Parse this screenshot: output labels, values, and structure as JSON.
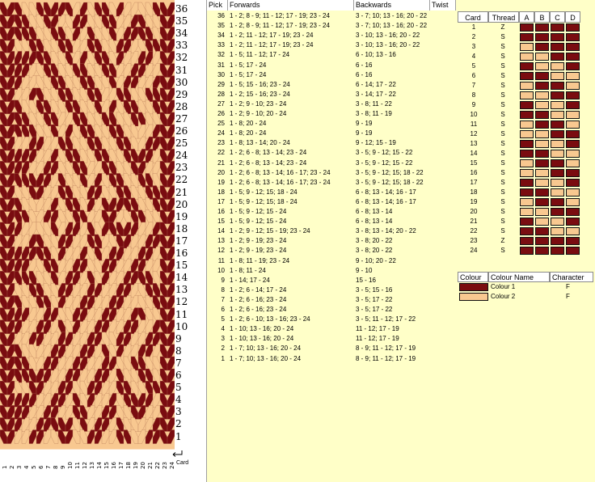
{
  "colors": {
    "dark": "#7a0c10",
    "light": "#f8c890",
    "panel_bg": "#ffffc8",
    "header_bg": "#ffffff"
  },
  "pattern": {
    "row_labels": [
      "36",
      "35",
      "34",
      "33",
      "32",
      "31",
      "30",
      "29",
      "28",
      "27",
      "26",
      "25",
      "24",
      "23",
      "22",
      "21",
      "20",
      "19",
      "18",
      "17",
      "16",
      "15",
      "14",
      "13",
      "12",
      "11",
      "10",
      "9",
      "8",
      "7",
      "6",
      "5",
      "4",
      "3",
      "2",
      "1"
    ],
    "card_labels": [
      "1",
      "2",
      "3",
      "4",
      "5",
      "6",
      "7",
      "8",
      "9",
      "10",
      "11",
      "12",
      "13",
      "14",
      "15",
      "16",
      "17",
      "18",
      "19",
      "20",
      "21",
      "22",
      "23",
      "24"
    ],
    "card_axis_label": "Card"
  },
  "pick_table": {
    "headers": {
      "pick": "Pick",
      "forwards": "Forwards",
      "backwards": "Backwards",
      "twist": "Twist"
    },
    "rows": [
      {
        "pick": "36",
        "fwd": "1 - 2; 8 - 9; 11 - 12; 17 - 19; 23 - 24",
        "bwd": "3 - 7; 10; 13 - 16; 20 - 22"
      },
      {
        "pick": "35",
        "fwd": "1 - 2; 8 - 9; 11 - 12; 17 - 19; 23 - 24",
        "bwd": "3 - 7; 10; 13 - 16; 20 - 22"
      },
      {
        "pick": "34",
        "fwd": "1 - 2; 11 - 12; 17 - 19; 23 - 24",
        "bwd": "3 - 10; 13 - 16; 20 - 22"
      },
      {
        "pick": "33",
        "fwd": "1 - 2; 11 - 12; 17 - 19; 23 - 24",
        "bwd": "3 - 10; 13 - 16; 20 - 22"
      },
      {
        "pick": "32",
        "fwd": "1 - 5; 11 - 12; 17 - 24",
        "bwd": "6 - 10; 13 - 16"
      },
      {
        "pick": "31",
        "fwd": "1 - 5; 17 - 24",
        "bwd": "6 - 16"
      },
      {
        "pick": "30",
        "fwd": "1 - 5; 17 - 24",
        "bwd": "6 - 16"
      },
      {
        "pick": "29",
        "fwd": "1 - 5; 15 - 16; 23 - 24",
        "bwd": "6 - 14; 17 - 22"
      },
      {
        "pick": "28",
        "fwd": "1 - 2; 15 - 16; 23 - 24",
        "bwd": "3 - 14; 17 - 22"
      },
      {
        "pick": "27",
        "fwd": "1 - 2; 9 - 10; 23 - 24",
        "bwd": "3 - 8; 11 - 22"
      },
      {
        "pick": "26",
        "fwd": "1 - 2; 9 - 10; 20 - 24",
        "bwd": "3 - 8; 11 - 19"
      },
      {
        "pick": "25",
        "fwd": "1 - 8; 20 - 24",
        "bwd": "9 - 19"
      },
      {
        "pick": "24",
        "fwd": "1 - 8; 20 - 24",
        "bwd": "9 - 19"
      },
      {
        "pick": "23",
        "fwd": "1 - 8; 13 - 14; 20 - 24",
        "bwd": "9 - 12; 15 - 19"
      },
      {
        "pick": "22",
        "fwd": "1 - 2; 6 - 8; 13 - 14; 23 - 24",
        "bwd": "3 - 5; 9 - 12; 15 - 22"
      },
      {
        "pick": "21",
        "fwd": "1 - 2; 6 - 8; 13 - 14; 23 - 24",
        "bwd": "3 - 5; 9 - 12; 15 - 22"
      },
      {
        "pick": "20",
        "fwd": "1 - 2; 6 - 8; 13 - 14; 16 - 17; 23 - 24",
        "bwd": "3 - 5; 9 - 12; 15; 18 - 22"
      },
      {
        "pick": "19",
        "fwd": "1 - 2; 6 - 8; 13 - 14; 16 - 17; 23 - 24",
        "bwd": "3 - 5; 9 - 12; 15; 18 - 22"
      },
      {
        "pick": "18",
        "fwd": "1 - 5; 9 - 12; 15; 18 - 24",
        "bwd": "6 - 8; 13 - 14; 16 - 17"
      },
      {
        "pick": "17",
        "fwd": "1 - 5; 9 - 12; 15; 18 - 24",
        "bwd": "6 - 8; 13 - 14; 16 - 17"
      },
      {
        "pick": "16",
        "fwd": "1 - 5; 9 - 12; 15 - 24",
        "bwd": "6 - 8; 13 - 14"
      },
      {
        "pick": "15",
        "fwd": "1 - 5; 9 - 12; 15 - 24",
        "bwd": "6 - 8; 13 - 14"
      },
      {
        "pick": "14",
        "fwd": "1 - 2; 9 - 12; 15 - 19; 23 - 24",
        "bwd": "3 - 8; 13 - 14; 20 - 22"
      },
      {
        "pick": "13",
        "fwd": "1 - 2; 9 - 19; 23 - 24",
        "bwd": "3 - 8; 20 - 22"
      },
      {
        "pick": "12",
        "fwd": "1 - 2; 9 - 19; 23 - 24",
        "bwd": "3 - 8; 20 - 22"
      },
      {
        "pick": "11",
        "fwd": "1 - 8; 11 - 19; 23 - 24",
        "bwd": "9 - 10; 20 - 22"
      },
      {
        "pick": "10",
        "fwd": "1 - 8; 11 - 24",
        "bwd": "9 - 10"
      },
      {
        "pick": "9",
        "fwd": "1 - 14; 17 - 24",
        "bwd": "15 - 16"
      },
      {
        "pick": "8",
        "fwd": "1 - 2; 6 - 14; 17 - 24",
        "bwd": "3 - 5; 15 - 16"
      },
      {
        "pick": "7",
        "fwd": "1 - 2; 6 - 16; 23 - 24",
        "bwd": "3 - 5; 17 - 22"
      },
      {
        "pick": "6",
        "fwd": "1 - 2; 6 - 16; 23 - 24",
        "bwd": "3 - 5; 17 - 22"
      },
      {
        "pick": "5",
        "fwd": "1 - 2; 6 - 10; 13 - 16; 23 - 24",
        "bwd": "3 - 5; 11 - 12; 17 - 22"
      },
      {
        "pick": "4",
        "fwd": "1 - 10; 13 - 16; 20 - 24",
        "bwd": "11 - 12; 17 - 19"
      },
      {
        "pick": "3",
        "fwd": "1 - 10; 13 - 16; 20 - 24",
        "bwd": "11 - 12; 17 - 19"
      },
      {
        "pick": "2",
        "fwd": "1 - 7; 10; 13 - 16; 20 - 24",
        "bwd": "8 - 9; 11 - 12; 17 - 19"
      },
      {
        "pick": "1",
        "fwd": "1 - 7; 10; 13 - 16; 20 - 24",
        "bwd": "8 - 9; 11 - 12; 17 - 19"
      }
    ]
  },
  "threading": {
    "headers": {
      "card": "Card",
      "thread": "Thread",
      "a": "A",
      "b": "B",
      "c": "C",
      "d": "D"
    },
    "rows": [
      {
        "card": "1",
        "dir": "Z",
        "holes": [
          "d",
          "d",
          "d",
          "d"
        ]
      },
      {
        "card": "2",
        "dir": "S",
        "holes": [
          "d",
          "d",
          "d",
          "d"
        ]
      },
      {
        "card": "3",
        "dir": "S",
        "holes": [
          "l",
          "d",
          "d",
          "d"
        ]
      },
      {
        "card": "4",
        "dir": "S",
        "holes": [
          "l",
          "l",
          "d",
          "d"
        ]
      },
      {
        "card": "5",
        "dir": "S",
        "holes": [
          "d",
          "l",
          "l",
          "d"
        ]
      },
      {
        "card": "6",
        "dir": "S",
        "holes": [
          "d",
          "d",
          "l",
          "l"
        ]
      },
      {
        "card": "7",
        "dir": "S",
        "holes": [
          "l",
          "d",
          "d",
          "l"
        ]
      },
      {
        "card": "8",
        "dir": "S",
        "holes": [
          "l",
          "l",
          "d",
          "d"
        ]
      },
      {
        "card": "9",
        "dir": "S",
        "holes": [
          "d",
          "l",
          "l",
          "d"
        ]
      },
      {
        "card": "10",
        "dir": "S",
        "holes": [
          "d",
          "d",
          "l",
          "l"
        ]
      },
      {
        "card": "11",
        "dir": "S",
        "holes": [
          "l",
          "d",
          "d",
          "l"
        ]
      },
      {
        "card": "12",
        "dir": "S",
        "holes": [
          "l",
          "l",
          "d",
          "d"
        ]
      },
      {
        "card": "13",
        "dir": "S",
        "holes": [
          "d",
          "l",
          "l",
          "d"
        ]
      },
      {
        "card": "14",
        "dir": "S",
        "holes": [
          "d",
          "d",
          "l",
          "l"
        ]
      },
      {
        "card": "15",
        "dir": "S",
        "holes": [
          "l",
          "d",
          "d",
          "l"
        ]
      },
      {
        "card": "16",
        "dir": "S",
        "holes": [
          "l",
          "l",
          "d",
          "d"
        ]
      },
      {
        "card": "17",
        "dir": "S",
        "holes": [
          "d",
          "l",
          "l",
          "d"
        ]
      },
      {
        "card": "18",
        "dir": "S",
        "holes": [
          "d",
          "d",
          "l",
          "l"
        ]
      },
      {
        "card": "19",
        "dir": "S",
        "holes": [
          "l",
          "d",
          "d",
          "l"
        ]
      },
      {
        "card": "20",
        "dir": "S",
        "holes": [
          "l",
          "l",
          "d",
          "d"
        ]
      },
      {
        "card": "21",
        "dir": "S",
        "holes": [
          "d",
          "l",
          "l",
          "d"
        ]
      },
      {
        "card": "22",
        "dir": "S",
        "holes": [
          "d",
          "d",
          "l",
          "l"
        ]
      },
      {
        "card": "23",
        "dir": "Z",
        "holes": [
          "d",
          "d",
          "d",
          "d"
        ]
      },
      {
        "card": "24",
        "dir": "S",
        "holes": [
          "d",
          "d",
          "d",
          "d"
        ]
      }
    ]
  },
  "colour_table": {
    "headers": {
      "colour": "Colour",
      "name": "Colour Name",
      "character": "Character"
    },
    "rows": [
      {
        "swatch": "dark",
        "name": "Colour 1",
        "char": "F"
      },
      {
        "swatch": "light",
        "name": "Colour 2",
        "char": "F"
      }
    ]
  }
}
